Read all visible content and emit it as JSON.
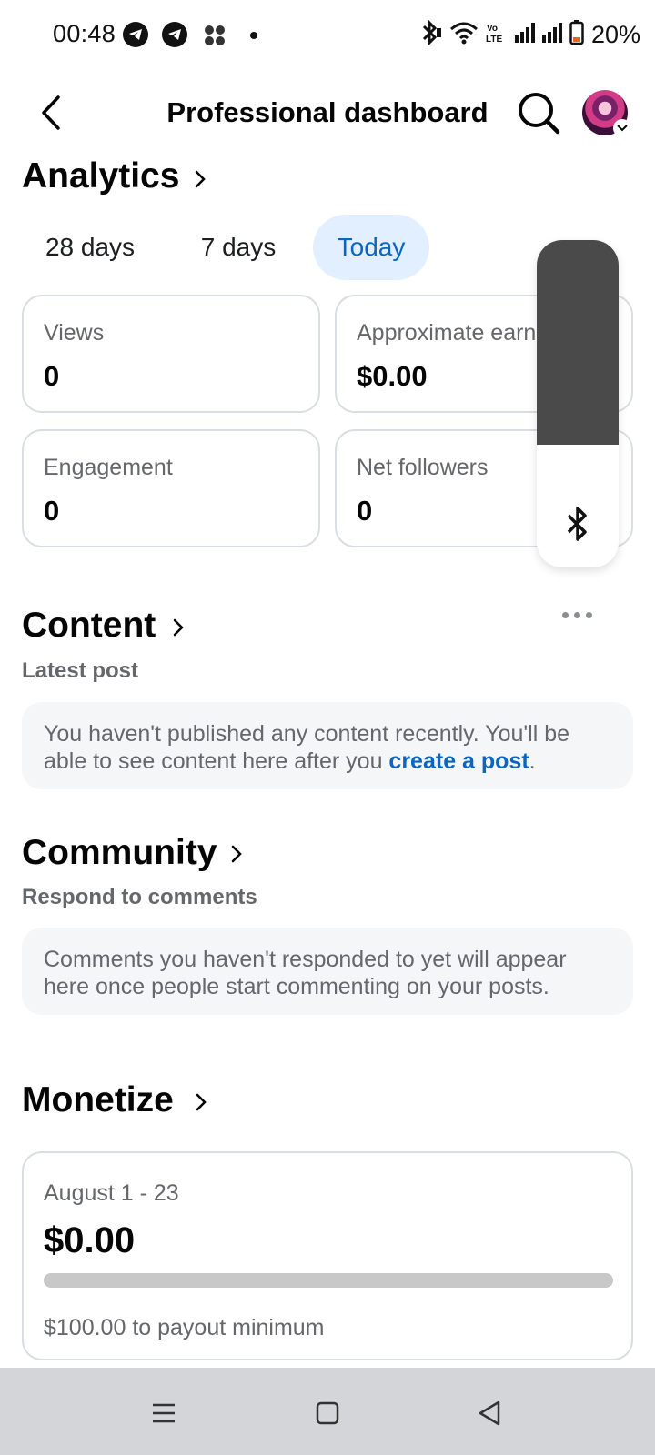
{
  "status_bar": {
    "time": "00:48",
    "battery": "20%",
    "icons": [
      "telegram-icon",
      "telegram-icon",
      "app-grid-icon",
      "notification-dot-icon",
      "bluetooth-icon",
      "wifi-icon",
      "volte-icon",
      "signal-icon",
      "signal-icon",
      "battery-icon"
    ]
  },
  "header": {
    "title": "Professional dashboard",
    "back_icon": "chevron-left-icon",
    "search_icon": "search-icon"
  },
  "analytics": {
    "title": "Analytics",
    "tabs": [
      {
        "label": "28 days",
        "active": false
      },
      {
        "label": "7 days",
        "active": false
      },
      {
        "label": "Today",
        "active": true
      }
    ],
    "stats": [
      {
        "label": "Views",
        "value": "0"
      },
      {
        "label": "Approximate earnings",
        "value": "$0.00"
      },
      {
        "label": "Engagement",
        "value": "0"
      },
      {
        "label": "Net followers",
        "value": "0"
      }
    ]
  },
  "content": {
    "title": "Content",
    "subtitle": "Latest post",
    "message": "You haven't published any content recently. You'll be able to see content here after you ",
    "link": "create a post",
    "message_end": "."
  },
  "community": {
    "title": "Community",
    "subtitle": "Respond to comments",
    "message": "Comments you haven't responded to yet will appear here once people start commenting on your posts."
  },
  "monetize": {
    "title": "Monetize",
    "date_range": "August 1 - 23",
    "amount": "$0.00",
    "progress_fraction": 0.0,
    "payout_note": "$100.00 to payout minimum"
  },
  "colors": {
    "accent": "#0a66c2",
    "tab_active_bg": "#e2efff",
    "muted_text": "#65676b",
    "overlay_dark": "#4a4a4a"
  }
}
